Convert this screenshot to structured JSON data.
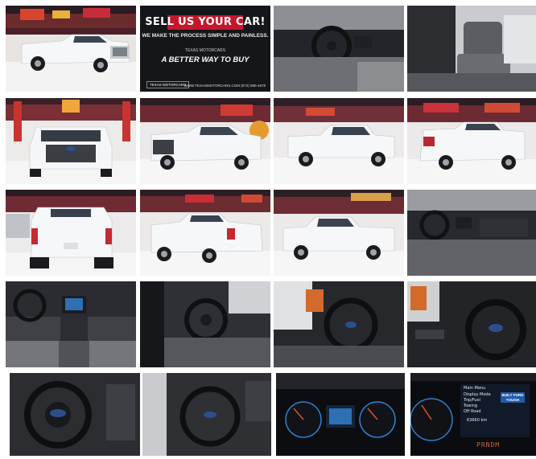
{
  "ad": {
    "headline": "SELL US YOUR CAR!",
    "subline": "WE MAKE THE PROCESS SIMPLE AND PAINLESS.",
    "brand_line": "TEXAS MOTORCARS",
    "tagline": "A BETTER WAY TO BUY",
    "logo_text": "TEXAS MOTORCARS",
    "footer": "WWW.TEXASMOTORCARS.COM  (972) 580-4878"
  },
  "dash_menu": {
    "menu_title": "Main Menu",
    "items": [
      "Display Mode",
      "Trip/Fuel",
      "Towing",
      "Off Road"
    ],
    "odometer": "63660 km",
    "badge": "BUILT FORD TOUGH",
    "gear": "PRNDM"
  },
  "colors": {
    "truck_white": "#f2f3f5",
    "showroom_red": "#b3212c",
    "ad_red": "#c4172c",
    "dash_blue": "#2f7fd0"
  },
  "photos": [
    "truck-front-three-quarter",
    "sell-your-car-ad",
    "interior-driver-dash",
    "interior-front-seats",
    "truck-front",
    "truck-front-quarter",
    "truck-side-profile",
    "truck-rear-quarter",
    "truck-rear",
    "truck-rear-quarter-left",
    "truck-left-profile",
    "interior-passenger-dash",
    "dashboard-center-console",
    "interior-driver-door",
    "steering-wheel-side",
    "steering-wheel-close",
    "steering-wheel-front",
    "steering-wheel-angled",
    "instrument-cluster",
    "cluster-menu-display"
  ]
}
